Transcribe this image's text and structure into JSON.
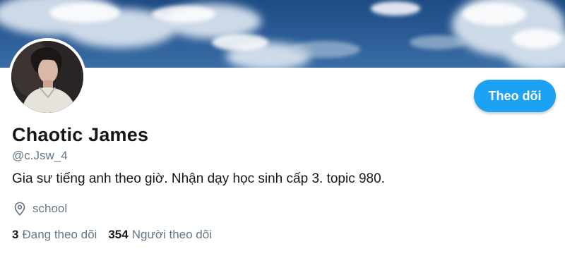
{
  "profile": {
    "display_name": "Chaotic James",
    "handle": "@c.Jsw_4",
    "bio": "Gia sư tiếng anh theo giờ. Nhận dạy học sinh cấp 3. topic 980.",
    "location": "school",
    "following_count": "3",
    "following_label": "Đang theo dõi",
    "followers_count": "354",
    "followers_label": "Người theo dõi"
  },
  "actions": {
    "follow_label": "Theo dõi"
  },
  "icons": {
    "location": "map-pin-icon"
  },
  "colors": {
    "accent": "#1da1f2",
    "secondary_text": "#657786",
    "primary_text": "#14171a"
  }
}
